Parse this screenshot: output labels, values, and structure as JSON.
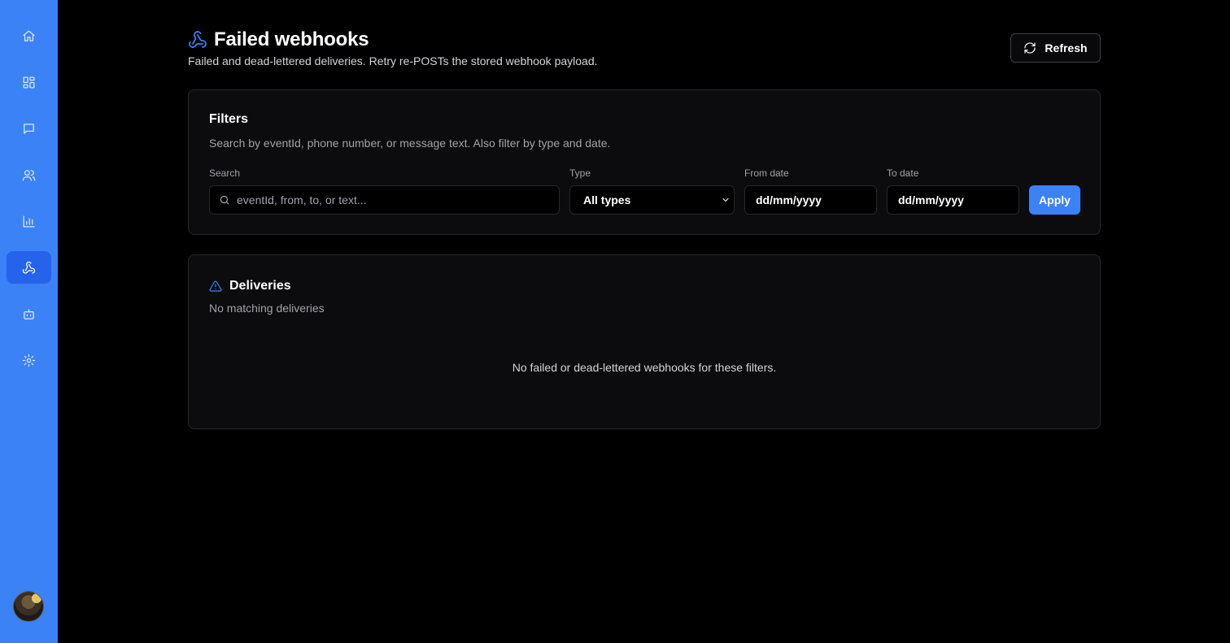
{
  "sidebar": {
    "items": [
      {
        "icon": "home-icon",
        "name": "nav-home"
      },
      {
        "icon": "dashboard-grid-icon",
        "name": "nav-dashboard"
      },
      {
        "icon": "message-icon",
        "name": "nav-messages"
      },
      {
        "icon": "users-icon",
        "name": "nav-contacts"
      },
      {
        "icon": "bar-chart-icon",
        "name": "nav-analytics"
      },
      {
        "icon": "webhook-icon",
        "name": "nav-webhooks",
        "active": true
      },
      {
        "icon": "bot-icon",
        "name": "nav-bots"
      },
      {
        "icon": "gear-icon",
        "name": "nav-settings"
      }
    ],
    "accent_color": "#3b82f6",
    "active_color": "#2563eb"
  },
  "header": {
    "title": "Failed webhooks",
    "subtitle": "Failed and dead-lettered deliveries. Retry re-POSTs the stored webhook payload.",
    "refresh_label": "Refresh"
  },
  "filters": {
    "title": "Filters",
    "description": "Search by eventId, phone number, or message text. Also filter by type and date.",
    "search_label": "Search",
    "search_placeholder": "eventId, from, to, or text...",
    "type_label": "Type",
    "type_value": "All types",
    "from_label": "From date",
    "from_value": "dd/mm/yyyy",
    "to_label": "To date",
    "to_value": "dd/mm/yyyy",
    "apply_label": "Apply"
  },
  "deliveries": {
    "title": "Deliveries",
    "subtitle": "No matching deliveries",
    "empty_message": "No failed or dead-lettered webhooks for these filters."
  }
}
